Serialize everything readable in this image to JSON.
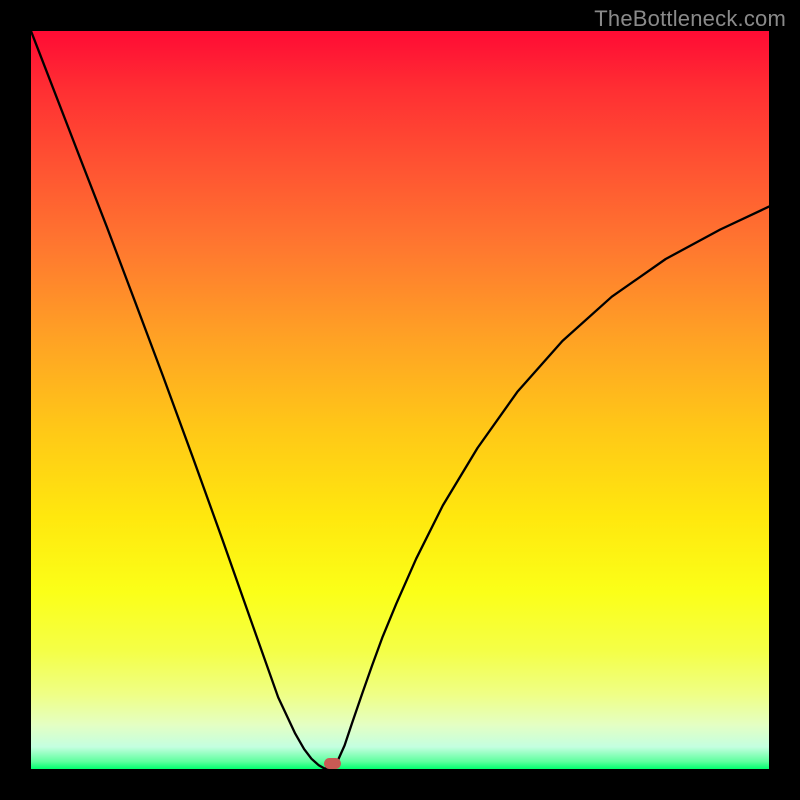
{
  "watermark": "TheBottleneck.com",
  "marker": {
    "x_frac": 0.408,
    "y_frac": 0.992
  },
  "chart_data": {
    "type": "line",
    "title": "",
    "xlabel": "",
    "ylabel": "",
    "xlim": [
      0,
      1
    ],
    "ylim": [
      0,
      1
    ],
    "grid": false,
    "legend": false,
    "x": [
      0.0,
      0.034,
      0.068,
      0.103,
      0.141,
      0.179,
      0.219,
      0.259,
      0.297,
      0.335,
      0.358,
      0.37,
      0.38,
      0.39,
      0.397,
      0.404,
      0.41,
      0.416,
      0.425,
      0.435,
      0.449,
      0.462,
      0.476,
      0.495,
      0.522,
      0.558,
      0.605,
      0.659,
      0.72,
      0.787,
      0.86,
      0.934,
      1.0
    ],
    "y": [
      1.0,
      0.912,
      0.824,
      0.734,
      0.633,
      0.532,
      0.423,
      0.312,
      0.204,
      0.097,
      0.048,
      0.027,
      0.014,
      0.005,
      0.001,
      0.0,
      0.003,
      0.012,
      0.032,
      0.062,
      0.103,
      0.14,
      0.178,
      0.224,
      0.285,
      0.357,
      0.435,
      0.511,
      0.58,
      0.64,
      0.691,
      0.731,
      0.762
    ],
    "background_gradient": {
      "direction": "vertical",
      "stops": [
        {
          "pos": 0.0,
          "color": "#ff0b34"
        },
        {
          "pos": 0.5,
          "color": "#ffc817"
        },
        {
          "pos": 0.8,
          "color": "#f4ff47"
        },
        {
          "pos": 1.0,
          "color": "#00ff6e"
        }
      ]
    },
    "annotations": [
      {
        "type": "marker",
        "x": 0.408,
        "y": 0.008,
        "color": "#c85a54",
        "shape": "rounded-rect"
      }
    ]
  }
}
